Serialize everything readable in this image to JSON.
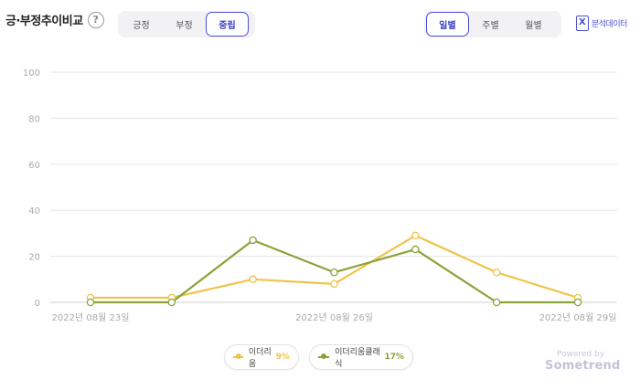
{
  "header": {
    "title": "긍·부정추이비교",
    "help_icon": "?",
    "sentiment_tabs": [
      "긍정",
      "부정",
      "중립"
    ],
    "sentiment_active": 2,
    "period_tabs": [
      "일별",
      "주별",
      "월별"
    ],
    "period_active": 0,
    "export_label": "분석데이터",
    "export_icon": "excel-icon"
  },
  "chart_data": {
    "type": "line",
    "x": [
      "2022년 08월 23일",
      "2022년 08월 24일",
      "2022년 08월 25일",
      "2022년 08월 26일",
      "2022년 08월 27일",
      "2022년 08월 28일",
      "2022년 08월 29일"
    ],
    "x_tick_labels": [
      "2022년 08월 23일",
      "2022년 08월 26일",
      "2022년 08월 29일"
    ],
    "ylim": [
      0,
      100
    ],
    "yticks": [
      0,
      20,
      40,
      60,
      80,
      100
    ],
    "grid": true,
    "series": [
      {
        "name": "이더리움",
        "values": [
          2,
          2,
          10,
          8,
          29,
          13,
          2
        ],
        "color": "#f0c34a",
        "percent": "9%"
      },
      {
        "name": "이더리움클래식",
        "values": [
          0,
          0,
          27,
          13,
          23,
          0,
          0
        ],
        "color": "#8aa43a",
        "percent": "17%"
      }
    ],
    "legend": "bottom-center"
  },
  "footer": {
    "powered_by": "Powered by",
    "brand": "Sometrend"
  }
}
